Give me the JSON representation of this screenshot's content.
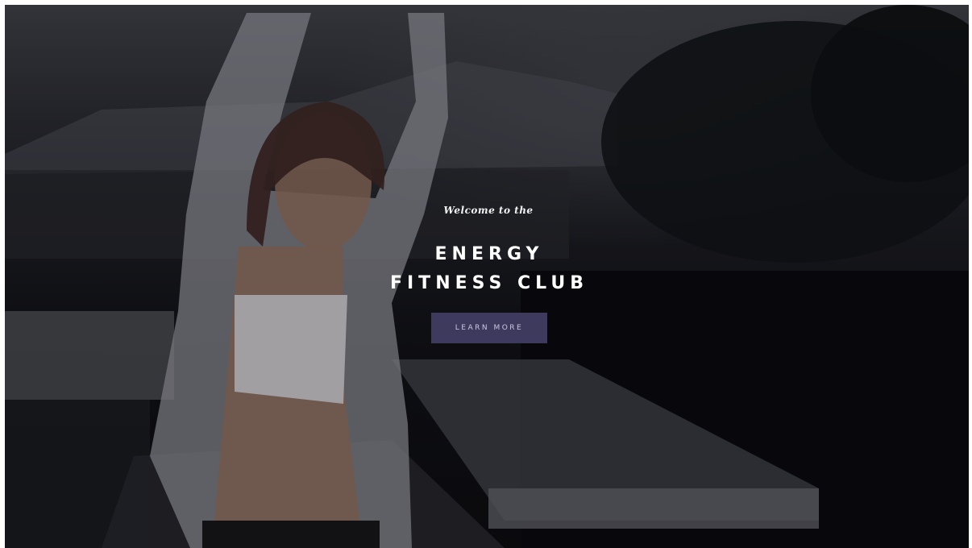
{
  "hero": {
    "eyebrow": "Welcome to the",
    "title_line1": "ENERGY",
    "title_line2": "FITNESS CLUB",
    "cta_label": "LEARN MORE"
  },
  "colors": {
    "cta_background": "#3e3a5e",
    "cta_text": "#c9c6e0",
    "text": "#ffffff"
  }
}
